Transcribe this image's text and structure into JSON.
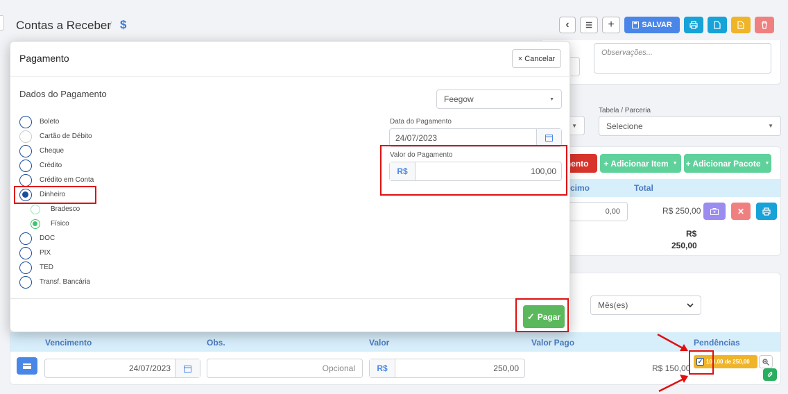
{
  "page": {
    "title": "Contas a Receber",
    "separator": "/",
    "title_icon": "$"
  },
  "toolbar": {
    "prev_icon": "‹",
    "list_icon": "☰",
    "add_icon": "+",
    "save_label": "SALVAR",
    "print_icon": "print",
    "doc_icon": "doc",
    "pdf_icon": "file",
    "delete_icon": "trash"
  },
  "background": {
    "observacoes_placeholder": "Observações...",
    "tabela_label": "Tabela / Parceria",
    "tabela_value": "Selecione",
    "adicionar_item": "+ Adicionar Item",
    "adicionar_pacote": "+ Adicionar Pacote",
    "lancamento_partial": "mento",
    "col_desconto_partial": "cimo",
    "col_total": "Total",
    "desconto_value": "0,00",
    "total_value": "R$ 250,00",
    "sum_currency": "R$",
    "sum_value": "250,00",
    "periodo_value": "Mês(es)"
  },
  "modal": {
    "title": "Pagamento",
    "cancel_label": "Cancelar",
    "section_title": "Dados do Pagamento",
    "gateway_value": "Feegow",
    "payment_methods": [
      {
        "label": "Boleto",
        "checked": false
      },
      {
        "label": "Cartão de Débito",
        "checked": false
      },
      {
        "label": "Cheque",
        "checked": false
      },
      {
        "label": "Crédito",
        "checked": false
      },
      {
        "label": "Crédito em Conta",
        "checked": false
      },
      {
        "label": "Dinheiro",
        "checked": true
      },
      {
        "label": "DOC",
        "checked": false
      },
      {
        "label": "PIX",
        "checked": false
      },
      {
        "label": "TED",
        "checked": false
      },
      {
        "label": "Transf. Bancária",
        "checked": false
      }
    ],
    "sub_options": [
      {
        "label": "Bradesco",
        "checked": false
      },
      {
        "label": "Físico",
        "checked": true
      }
    ],
    "date_label": "Data do Pagamento",
    "date_value": "24/07/2023",
    "value_label": "Valor do Pagamento",
    "currency": "R$",
    "value": "100,00",
    "pay_label": "Pagar"
  },
  "installments": {
    "headers": {
      "vencimento": "Vencimento",
      "obs": "Obs.",
      "valor": "Valor",
      "valor_pago": "Valor Pago",
      "pendencias": "Pendências"
    },
    "row": {
      "vencimento": "24/07/2023",
      "obs_placeholder": "Opcional",
      "currency": "R$",
      "valor": "250,00",
      "valor_pago": "R$ 150,00",
      "pendencia_badge": "100,00 de 250,00"
    }
  }
}
